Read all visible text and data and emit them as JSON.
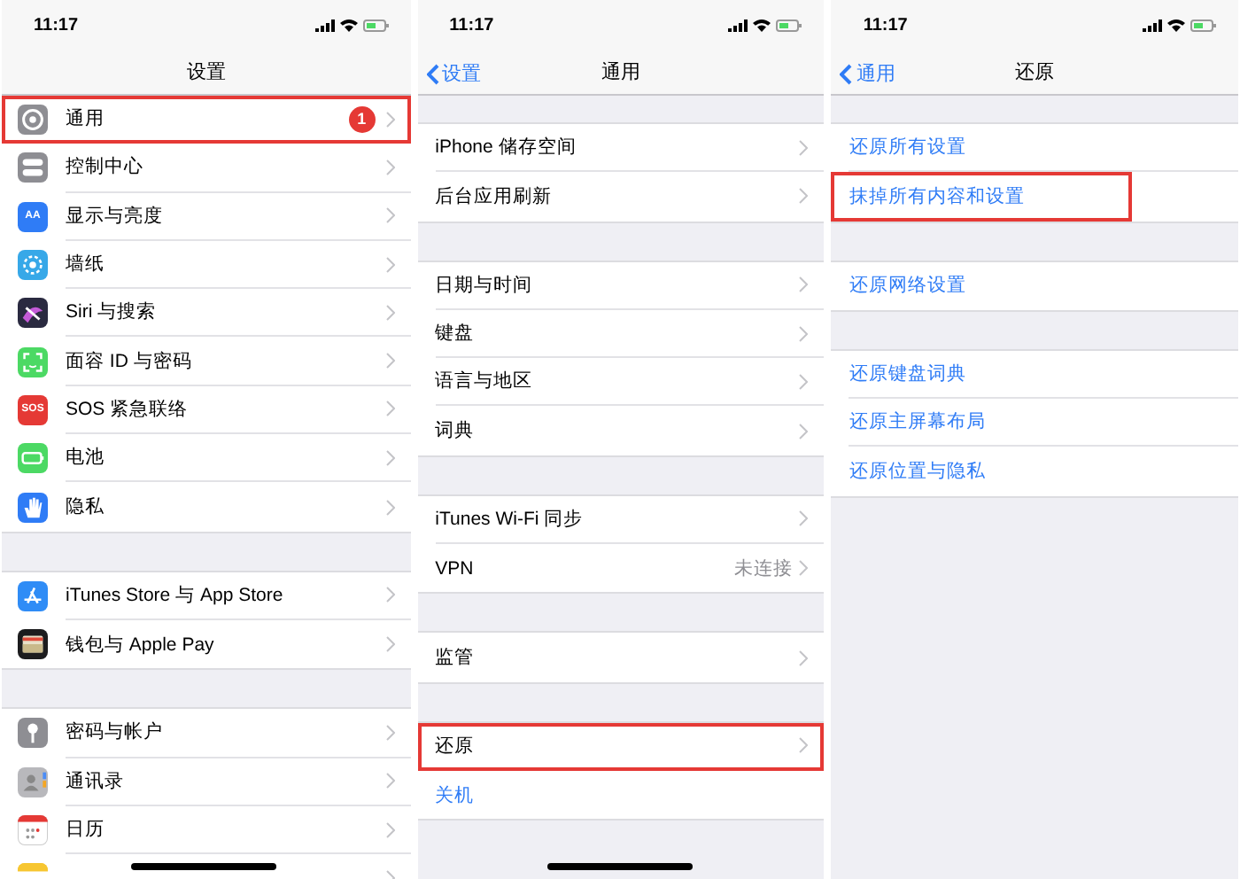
{
  "panels": [
    {
      "time": "11:17",
      "title": "设置",
      "lead_gap": false,
      "home_indicator": true,
      "groups": [
        {
          "rows": [
            {
              "label": "通用",
              "icon": {
                "kind": "gear",
                "color": "#8e8e93"
              },
              "badge": "1",
              "highlighted": true,
              "link": false
            },
            {
              "label": "控制中心",
              "icon": {
                "kind": "toggles",
                "color": "#8e8e93"
              },
              "highlighted": false,
              "link": false
            },
            {
              "label": "显示与亮度",
              "icon": {
                "kind": "glyph",
                "color": "#2f7cf6",
                "text": "AA"
              },
              "highlighted": false,
              "link": false
            },
            {
              "label": "墙纸",
              "icon": {
                "kind": "flower",
                "color": "#37a8e8"
              },
              "highlighted": false,
              "link": false
            },
            {
              "label": "Siri 与搜索",
              "icon": {
                "kind": "siri",
                "color": "#2a2a40"
              },
              "highlighted": false,
              "link": false
            },
            {
              "label": "面容 ID 与密码",
              "icon": {
                "kind": "face",
                "color": "#4cd964"
              },
              "highlighted": false,
              "link": false
            },
            {
              "label": "SOS 紧急联络",
              "icon": {
                "kind": "glyph",
                "color": "#e53935",
                "text": "SOS"
              },
              "highlighted": false,
              "link": false
            },
            {
              "label": "电池",
              "icon": {
                "kind": "battery",
                "color": "#4cd964"
              },
              "highlighted": false,
              "link": false
            },
            {
              "label": "隐私",
              "icon": {
                "kind": "hand",
                "color": "#2f7cf6"
              },
              "highlighted": false,
              "link": false
            }
          ]
        },
        {
          "rows": [
            {
              "label": "iTunes Store 与 App Store",
              "icon": {
                "kind": "appstore",
                "color": "#2f8cf6"
              },
              "highlighted": false,
              "link": false
            },
            {
              "label": "钱包与 Apple Pay",
              "icon": {
                "kind": "wallet",
                "color": "#1c1c1e"
              },
              "highlighted": false,
              "link": false
            }
          ]
        },
        {
          "rows": [
            {
              "label": "密码与帐户",
              "icon": {
                "kind": "key",
                "color": "#8e8e93"
              },
              "highlighted": false,
              "link": false
            },
            {
              "label": "通讯录",
              "icon": {
                "kind": "contacts",
                "color": "#b8b8bc"
              },
              "highlighted": false,
              "link": false
            },
            {
              "label": "日历",
              "icon": {
                "kind": "calendar",
                "color": "#ffffff"
              },
              "highlighted": false,
              "link": false
            },
            {
              "icon": {
                "kind": "notes",
                "color": "#f7c631"
              },
              "highlighted": false,
              "link": false
            }
          ]
        }
      ]
    },
    {
      "time": "11:17",
      "back": "设置",
      "title": "通用",
      "lead_gap": true,
      "home_indicator": true,
      "groups": [
        {
          "rows": [
            {
              "label": "iPhone 储存空间",
              "highlighted": false,
              "link": false
            },
            {
              "label": "后台应用刷新",
              "highlighted": false,
              "link": false
            }
          ]
        },
        {
          "rows": [
            {
              "label": "日期与时间",
              "highlighted": false,
              "link": false
            },
            {
              "label": "键盘",
              "highlighted": false,
              "link": false
            },
            {
              "label": "语言与地区",
              "highlighted": false,
              "link": false
            },
            {
              "label": "词典",
              "highlighted": false,
              "link": false
            }
          ]
        },
        {
          "rows": [
            {
              "label": "iTunes Wi-Fi 同步",
              "highlighted": false,
              "link": false
            },
            {
              "label": "VPN",
              "value": "未连接",
              "highlighted": false,
              "link": false
            }
          ]
        },
        {
          "rows": [
            {
              "label": "监管",
              "highlighted": false,
              "link": false
            }
          ]
        },
        {
          "rows": [
            {
              "label": "还原",
              "highlighted": true,
              "link": false
            },
            {
              "label": "关机",
              "highlighted": false,
              "link": true
            }
          ]
        }
      ]
    },
    {
      "time": "11:17",
      "back": "通用",
      "title": "还原",
      "lead_gap": true,
      "home_indicator": false,
      "groups": [
        {
          "rows": [
            {
              "label": "还原所有设置",
              "highlighted": false,
              "link": true
            },
            {
              "label": "抹掉所有内容和设置",
              "highlighted": true,
              "link": true
            }
          ]
        },
        {
          "rows": [
            {
              "label": "还原网络设置",
              "highlighted": false,
              "link": true
            }
          ]
        },
        {
          "rows": [
            {
              "label": "还原键盘词典",
              "highlighted": false,
              "link": true
            },
            {
              "label": "还原主屏幕布局",
              "highlighted": false,
              "link": true
            },
            {
              "label": "还原位置与隐私",
              "highlighted": false,
              "link": true
            }
          ]
        }
      ]
    }
  ]
}
